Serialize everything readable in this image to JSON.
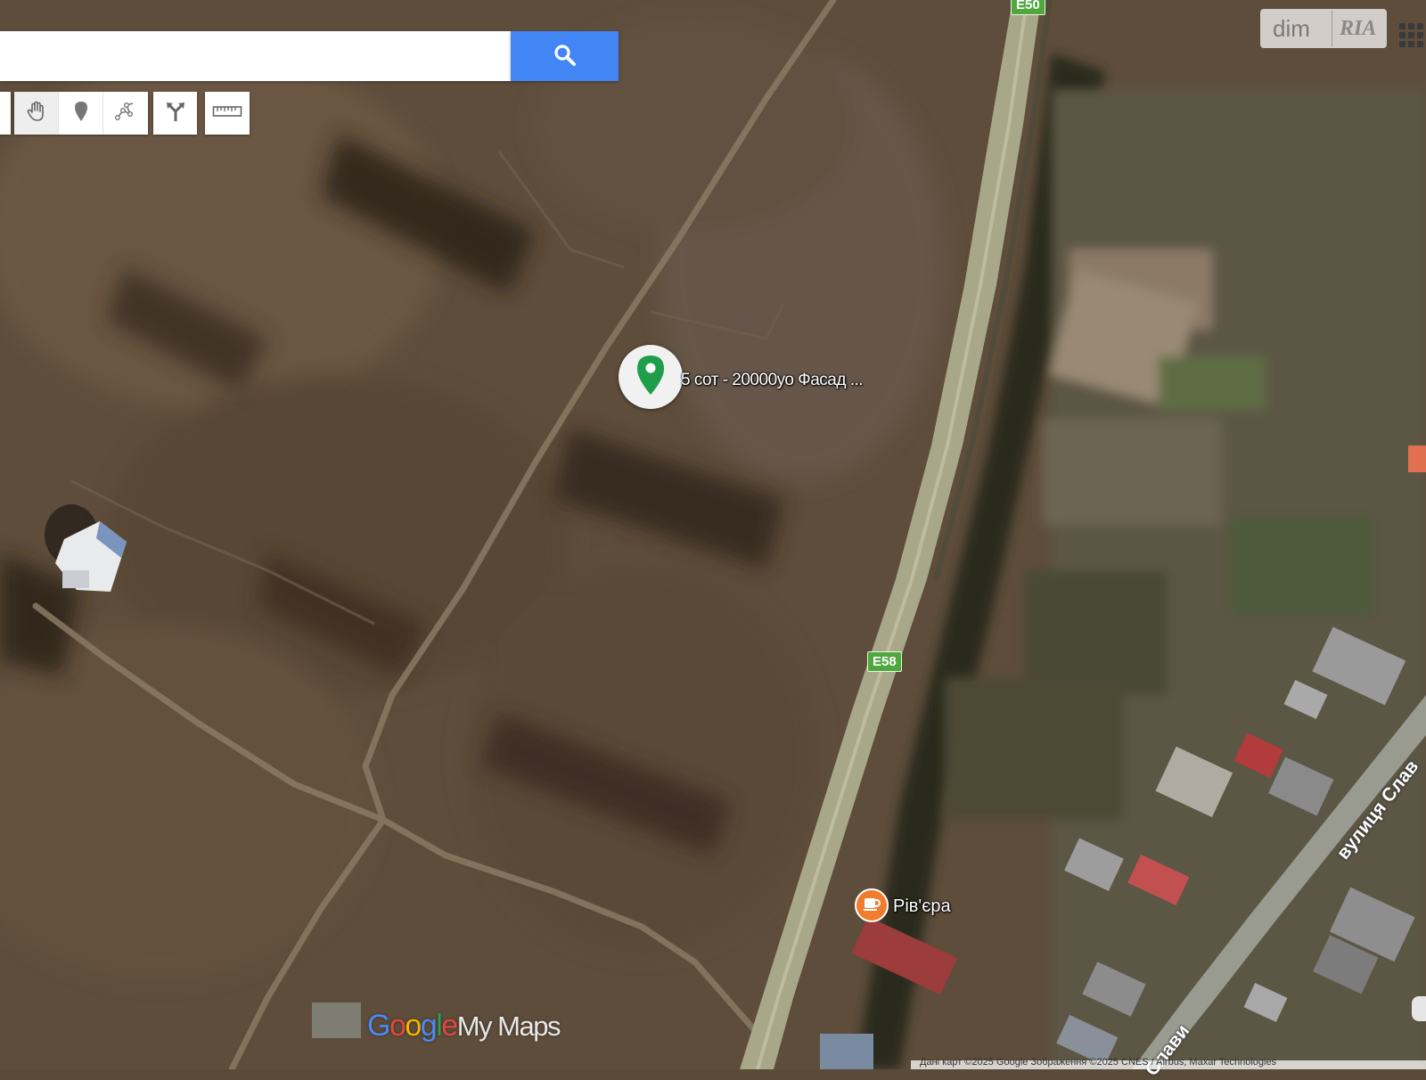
{
  "search": {
    "value": "",
    "placeholder": ""
  },
  "toolbar": {
    "tools": [
      {
        "name": "pan",
        "icon": "hand-icon",
        "active": true
      },
      {
        "name": "add-marker",
        "icon": "marker-icon",
        "active": false
      },
      {
        "name": "draw-line",
        "icon": "draw-line-icon",
        "active": false
      },
      {
        "name": "directions",
        "icon": "directions-icon",
        "active": false
      },
      {
        "name": "measure",
        "icon": "ruler-icon",
        "active": false
      }
    ]
  },
  "marker": {
    "label": "5 сот - 20000уо Фасад ...",
    "color": "#1e9e4a"
  },
  "roads": {
    "shield_top": "E50",
    "shield_middle": "E58",
    "shield_color": "#4fa83d"
  },
  "poi": {
    "name": "Рів'єра",
    "icon": "cafe-icon",
    "color": "#f07c2e"
  },
  "streets": {
    "right": "вулиця Слав",
    "bottom": "Слави"
  },
  "watermark": {
    "dim": "dim",
    "ria": "RIA"
  },
  "logo": {
    "g1": "G",
    "o1": "o",
    "o2": "o",
    "g2": "g",
    "l": "l",
    "e": "e",
    "suffix": "My Maps"
  },
  "attribution": {
    "text": "Дані карт ©2025 Google Зображення ©2025 CNES / Airbus, Maxar Technologies"
  },
  "colors": {
    "search_button": "#4285f4",
    "map_background": "#5a4a38"
  }
}
